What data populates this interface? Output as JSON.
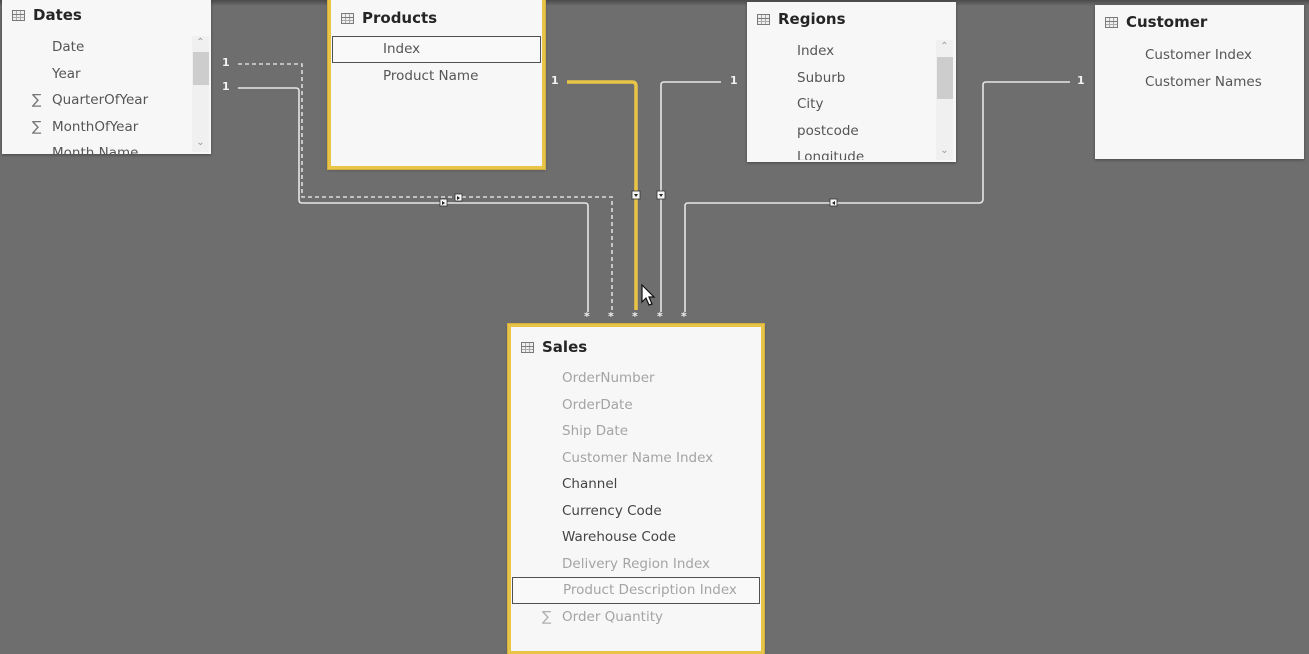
{
  "tables": {
    "dates": {
      "title": "Dates",
      "fields": [
        {
          "label": "Date",
          "sigma": false
        },
        {
          "label": "Year",
          "sigma": false
        },
        {
          "label": "QuarterOfYear",
          "sigma": true
        },
        {
          "label": "MonthOfYear",
          "sigma": true
        },
        {
          "label": "Month Name",
          "sigma": false
        }
      ]
    },
    "products": {
      "title": "Products",
      "fields": [
        {
          "label": "Index"
        },
        {
          "label": "Product Name"
        }
      ]
    },
    "regions": {
      "title": "Regions",
      "fields": [
        {
          "label": "Index"
        },
        {
          "label": "Suburb"
        },
        {
          "label": "City"
        },
        {
          "label": "postcode"
        },
        {
          "label": "Longitude"
        }
      ]
    },
    "customer": {
      "title": "Customer",
      "fields": [
        {
          "label": "Customer Index"
        },
        {
          "label": "Customer Names"
        }
      ]
    },
    "sales": {
      "title": "Sales",
      "fields": [
        {
          "label": "OrderNumber",
          "hidden": true
        },
        {
          "label": "OrderDate",
          "hidden": true
        },
        {
          "label": "Ship Date",
          "hidden": true
        },
        {
          "label": "Customer Name Index",
          "hidden": true
        },
        {
          "label": "Channel",
          "hidden": false
        },
        {
          "label": "Currency Code",
          "hidden": false
        },
        {
          "label": "Warehouse Code",
          "hidden": false
        },
        {
          "label": "Delivery Region Index",
          "hidden": true
        },
        {
          "label": "Product Description Index",
          "hidden": true,
          "selected": true
        },
        {
          "label": "Order Quantity",
          "hidden": true,
          "sigma": true
        }
      ]
    }
  },
  "relationships": {
    "one_label": "1",
    "many_label": "*"
  },
  "colors": {
    "canvas": "#6e6e6f",
    "highlight": "#e8c547",
    "line": "#e6e6e6"
  },
  "icons": {
    "table": "table-icon",
    "sigma": "∑",
    "scroll_up": "⌃",
    "scroll_down": "⌄"
  }
}
